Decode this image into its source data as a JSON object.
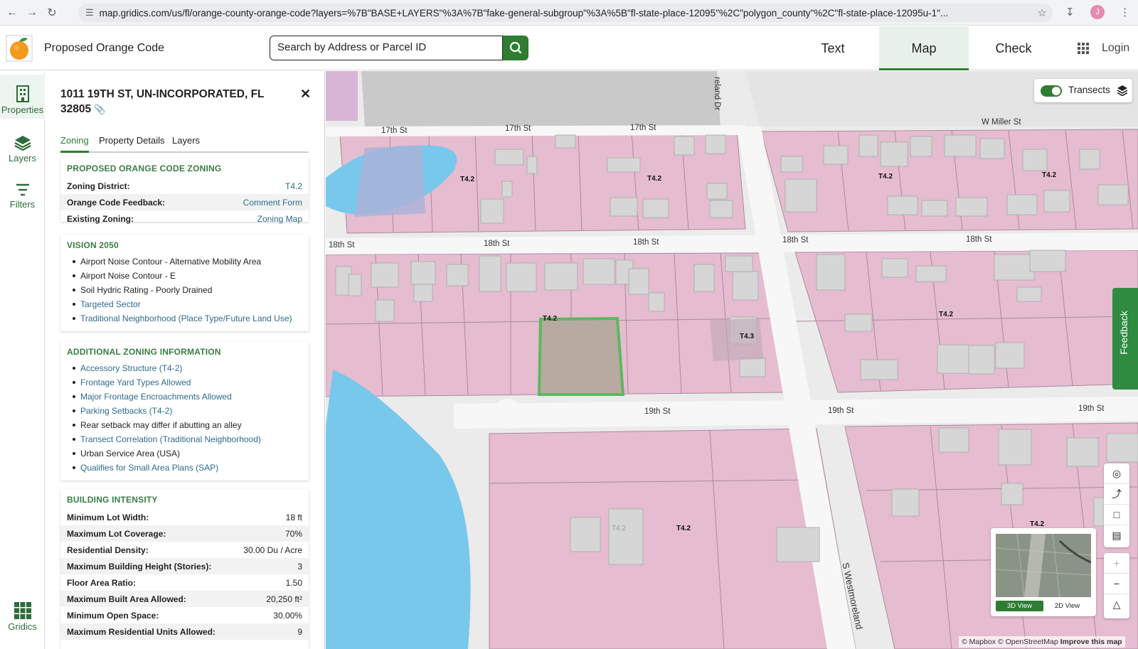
{
  "browser": {
    "url": "map.gridics.com/us/fl/orange-county-orange-code?layers=%7B\"BASE+LAYERS\"%3A%7B\"fake-general-subgroup\"%3A%5B\"fl-state-place-12095\"%2C\"polygon_county\"%2C\"fl-state-place-12095u-1\"...",
    "avatar": "J"
  },
  "header": {
    "title": "Proposed Orange Code",
    "search_placeholder": "Search by Address or Parcel ID",
    "tabs": [
      "Text",
      "Map",
      "Check"
    ],
    "active_tab": "Map",
    "login": "Login"
  },
  "rail": {
    "properties": "Properties",
    "layers": "Layers",
    "filters": "Filters",
    "gridics": "Gridics"
  },
  "panel": {
    "address": "1011 19TH ST, UN-INCORPORATED, FL 32805",
    "tabs": [
      "Zoning",
      "Property Details",
      "Layers"
    ],
    "zoning": {
      "heading": "PROPOSED ORANGE CODE ZONING",
      "rows": [
        {
          "k": "Zoning District:",
          "v": "T4.2"
        },
        {
          "k": "Orange Code Feedback:",
          "v": "Comment Form"
        },
        {
          "k": "Existing Zoning:",
          "v": "Zoning Map"
        }
      ]
    },
    "vision": {
      "heading": "VISION 2050",
      "items": [
        "Airport Noise Contour - Alternative Mobility Area",
        "Airport Noise Contour - E",
        "Soil Hydric Rating - Poorly Drained",
        "Targeted Sector",
        "Traditional Neighborhood (Place Type/Future Land Use)"
      ]
    },
    "additional": {
      "heading": "ADDITIONAL ZONING INFORMATION",
      "items": [
        "Accessory Structure (T4-2)",
        "Frontage Yard Types Allowed",
        "Major Frontage Encroachments Allowed",
        "Parking Setbacks (T4-2)",
        "Rear setback may differ if abutting an alley",
        "Transect Correlation (Traditional Neighborhood)",
        "Urban Service Area (USA)",
        "Qualifies for Small Area Plans (SAP)"
      ]
    },
    "intensity": {
      "heading": "BUILDING INTENSITY",
      "rows": [
        {
          "k": "Minimum Lot Width:",
          "v": "18 ft"
        },
        {
          "k": "Maximum Lot Coverage:",
          "v": "70%"
        },
        {
          "k": "Residential Density:",
          "v": "30.00 Du / Acre"
        },
        {
          "k": "Maximum Building Height (Stories):",
          "v": "3"
        },
        {
          "k": "Floor Area Ratio:",
          "v": "1.50"
        },
        {
          "k": "Maximum Built Area Allowed:",
          "v": "20,250 ft²"
        },
        {
          "k": "Minimum Open Space:",
          "v": "30.00%"
        },
        {
          "k": "Maximum Residential Units Allowed:",
          "v": "9"
        }
      ]
    }
  },
  "map": {
    "transects_label": "Transects",
    "feedback_label": "Feedback",
    "streets": {
      "s17a": "17th St",
      "s17b": "17th St",
      "s17c": "17th St",
      "s18a": "18th St",
      "s18b": "18th St",
      "s18c": "18th St",
      "s18d": "18th St",
      "s18e": "18th St",
      "s19a": "19th St",
      "s19b": "19th St",
      "s19c": "19th St",
      "miller": "W Miller St",
      "westmoreland": "S Westmoreland",
      "reland": "reland Dr"
    },
    "zone_label": "T4.2",
    "zone_label_alt": "T4.3",
    "view_3d": "3D View",
    "view_2d": "2D View",
    "attribution": "© Mapbox © OpenStreetMap",
    "improve": "Improve this map",
    "colors": {
      "parcel": "#e6bcd0",
      "road": "#f7f7f7",
      "water": "#78c8ec",
      "selected": "#5cb85c",
      "accent": "#2e7d32"
    }
  }
}
